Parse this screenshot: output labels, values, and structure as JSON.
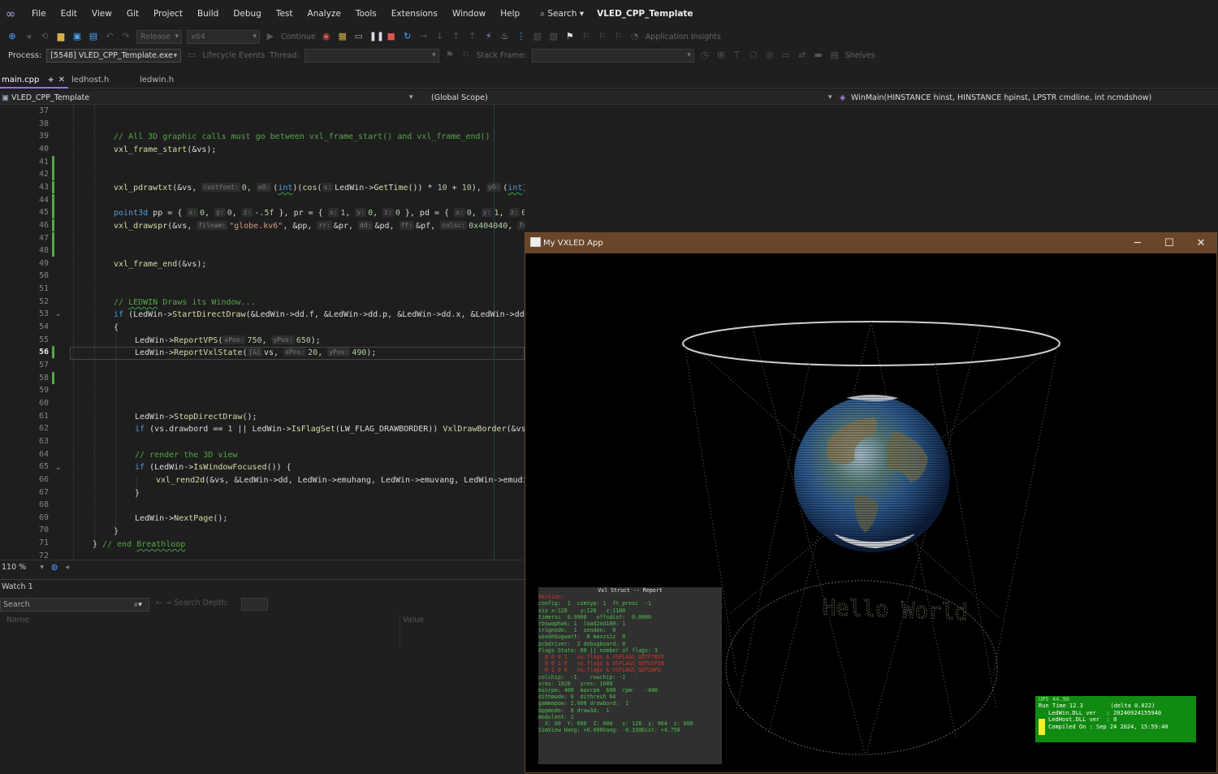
{
  "menu": {
    "items": [
      "File",
      "Edit",
      "View",
      "Git",
      "Project",
      "Build",
      "Debug",
      "Test",
      "Analyze",
      "Tools",
      "Extensions",
      "Window",
      "Help"
    ],
    "search_label": "Search",
    "solution": "VLED_CPP_Template"
  },
  "toolbar": {
    "config": "Release",
    "platform": "x64",
    "continue_label": "Continue",
    "app_insights": "Application Insights"
  },
  "debug_bar": {
    "process_label": "Process:",
    "process_value": "[5548] VLED_CPP_Template.exe",
    "lifecycle": "Lifecycle Events",
    "thread_label": "Thread:",
    "stack_label": "Stack Frame:",
    "shelves": "Shelves"
  },
  "tabs": [
    {
      "label": "main.cpp",
      "active": true
    },
    {
      "label": "ledhost.h",
      "active": false
    },
    {
      "label": "ledwin.h",
      "active": false
    }
  ],
  "nav": {
    "project": "VLED_CPP_Template",
    "scope": "(Global Scope)",
    "member": "WinMain(HINSTANCE hinst, HINSTANCE hpinst, LPSTR cmdline, int ncmdshow)"
  },
  "editor": {
    "zoom": "110 %",
    "current_line": 56,
    "first_line": 37,
    "last_line": 72,
    "changed_lines": [
      41,
      42,
      43,
      44,
      45,
      46,
      47,
      48,
      56,
      58
    ]
  },
  "watch": {
    "title": "Watch 1",
    "search_placeholder": "Search",
    "depth_label": "Search Depth:",
    "col_name": "Name",
    "col_value": "Value"
  },
  "app": {
    "title": "My VXLED App",
    "scene_text": "Hello World",
    "report_title": "Vxl Struct -- Report",
    "report_lines": [
      "Version:  ",
      "config:  1  comtyp: 1  ft_presc  -1",
      "siz x:128    y:128   z:1100",
      "timersc  0.9900   offsdist:  0.0000",
      "rbswaphak: 1  load2nd100: 1",
      "trignode:  1  sendon:  0",
      "usedebugwart:  0 maxzsiz  0",
      "pcbdriver:  2 debugboard: 0",
      "",
      "Flags State: 00 || number of flags: 3",
      "  0 0 0 1   vs.flags & VSFLAGS_GOTFT6XX",
      "  0 0 1 0   vs.flags & VSFLAGS_GOTUSPIN",
      "  0 1 0 0   vs.flags & VSFLAGS_GOTINFO",
      "",
      "colchip:  -1    rowchip: -1",
      "xres: 1920   yres: 1080",
      "minrpm: 400  maxrpm  600  rpm:   -400",
      "dithmode: 0  dithresh 64",
      "gammapow: 2.000 drawbord:  1",
      "bppmode:  0 draw3d:  1",
      "modulent: 1",
      "  X: 00  Y: 000  Z: 000   x: 128  y: 064  z: 000",
      "",
      "SimView Hang: +0.000Vang: -0.330Dist: +4.750"
    ],
    "status_lines": [
      "UPS 44.90",
      "Run Time 12.3        (delta 0.022)",
      "",
      "LedWin.DLL ver   : 20240924155940",
      "LedHost.DLL ver  : 0",
      "Compiled On : Sep 24 2024, 15:59:40"
    ]
  }
}
